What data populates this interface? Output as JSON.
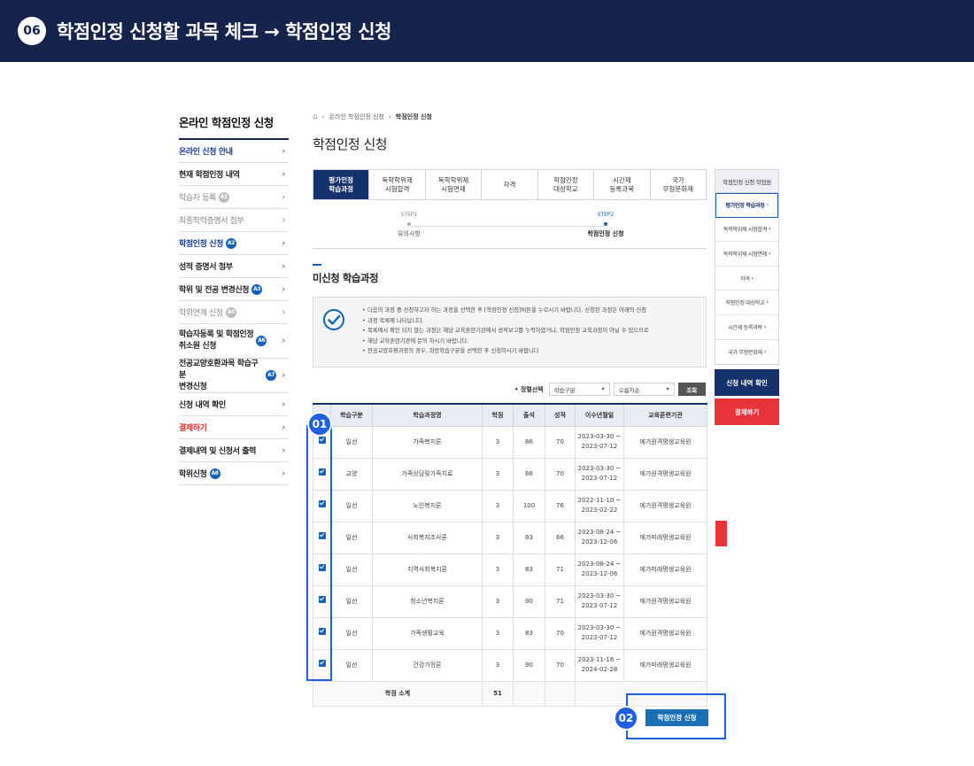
{
  "banner": {
    "step": "06",
    "title": "학점인정 신청할 과목 체크 → 학점인정 신청"
  },
  "sidebar": {
    "title": "온라인 학점인정 신청",
    "items": [
      {
        "label": "온라인 신청 안내",
        "badge": ""
      },
      {
        "label": "현재 학점인정 내역",
        "badge": ""
      },
      {
        "label": "학습자 등록",
        "badge": "A1"
      },
      {
        "label": "최종학력증명서 첨부",
        "badge": ""
      },
      {
        "label": "학점인정 신청",
        "badge": "A2"
      },
      {
        "label": "성적 증명서 첨부",
        "badge": ""
      },
      {
        "label": "학위 및 전공 변경신청",
        "badge": "A3"
      },
      {
        "label": "학위연계 신청",
        "badge": "A4"
      },
      {
        "label": "학습자등록 및 학점인정\n취소원 신청",
        "badge": "A6"
      },
      {
        "label": "전공교양호환과목 학습구분\n변경신청",
        "badge": "A7"
      },
      {
        "label": "신청 내역 확인",
        "badge": ""
      },
      {
        "label": "결제하기",
        "badge": ""
      },
      {
        "label": "결제내역 및 신청서 출력",
        "badge": ""
      },
      {
        "label": "학위신청",
        "badge": "A8"
      }
    ]
  },
  "breadcrumb": {
    "home": "⌂",
    "parent": "온라인 학점인정 신청",
    "current": "학점인정 신청"
  },
  "page_title": "학점인정 신청",
  "tabs": [
    "평가인정\n학습과정",
    "독학학위제\n시험합격",
    "독학학위제\n시험면제",
    "자격",
    "학점인정\n대상학교",
    "시간제\n등록과목",
    "국가\n무형문화재"
  ],
  "steps": [
    {
      "no": "STEP1",
      "label": "유의사항"
    },
    {
      "no": "STEP2",
      "label": "학점인정 신청"
    }
  ],
  "section_title": "미신청 학습과정",
  "notice": [
    "다음의 과정 중 신청하고자 하는 과정을 선택한 후 [학점인정 신청]버튼을 누르시기 바랍니다. 신청된 과정은 아래의 신청",
    "과정 목록에 나타납니다.",
    "목록에서 확인 되지 않는 과정은 해당 교육훈련기관에서 성적보고를 누락하였거나, 학점인정 교육과정이 아닐 수 있으므로",
    "해당 교육훈련기관에 문의 하시기 바랍니다.",
    "전공교양호환과정의 경우, 희망학습구분을 선택한 후 신청하시기 바랍니다"
  ],
  "filter": {
    "label": "정렬선택",
    "sort_field": "학습구분",
    "sort_order": "오름차순",
    "search": "조회"
  },
  "table": {
    "headers": [
      "",
      "학습구분",
      "학습과정명",
      "학점",
      "출석",
      "성적",
      "이수년월일",
      "교육훈련기관"
    ],
    "rows": [
      {
        "type": "일선",
        "name": "가족복지론",
        "credit": "3",
        "attend": "86",
        "grade": "70",
        "period": "2023-03-30 ~\n2023-07-12",
        "org": "에가원격평생교육원"
      },
      {
        "type": "교양",
        "name": "가족상담및가족치료",
        "credit": "3",
        "attend": "86",
        "grade": "70",
        "period": "2023-03-30 ~\n2023-07-12",
        "org": "에가원격평생교육원"
      },
      {
        "type": "일선",
        "name": "노인복지론",
        "credit": "3",
        "attend": "100",
        "grade": "76",
        "period": "2022-11-10 ~\n2023-02-22",
        "org": "에가원격평생교육원"
      },
      {
        "type": "일선",
        "name": "사회복지조사론",
        "credit": "3",
        "attend": "83",
        "grade": "66",
        "period": "2023-08-24 ~\n2023-12-06",
        "org": "에가미래평생교육원"
      },
      {
        "type": "일선",
        "name": "지역사회복지론",
        "credit": "3",
        "attend": "83",
        "grade": "71",
        "period": "2023-08-24 ~\n2023-12-06",
        "org": "에가미래평생교육원"
      },
      {
        "type": "일선",
        "name": "청소년복지론",
        "credit": "3",
        "attend": "90",
        "grade": "71",
        "period": "2023-03-30 ~\n2023-07-12",
        "org": "에가원격평생교육원"
      },
      {
        "type": "일선",
        "name": "가족생활교육",
        "credit": "3",
        "attend": "83",
        "grade": "70",
        "period": "2023-03-30 ~\n2023-07-12",
        "org": "에가원격평생교육원"
      },
      {
        "type": "일선",
        "name": "건강가정론",
        "credit": "3",
        "attend": "90",
        "grade": "70",
        "period": "2023-11-16 ~\n2024-02-28",
        "org": "에가미래평생교육원"
      }
    ],
    "sum_label": "학점 소계",
    "sum_value": "51"
  },
  "apply_button": "학점인정 신청",
  "callouts": {
    "first": "01",
    "second": "02"
  },
  "right_panel": {
    "title": "학점인정 신청 학점원",
    "items": [
      "평가인정 학습과정",
      "독학학위제 시험합격",
      "독학학위제 시험면제",
      "자격",
      "학점인정 대상학교",
      "시간제 등록과목",
      "국가 무형문화재"
    ],
    "check_button": "신청 내역 확인",
    "pay_button": "결제하기"
  },
  "colors": {
    "navy": "#16234a",
    "accent": "#1560b8",
    "highlight": "#1f5fe0",
    "danger": "#e8333a"
  }
}
